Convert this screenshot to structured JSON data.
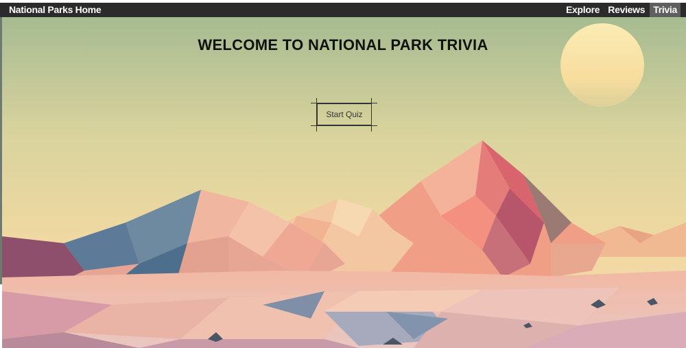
{
  "navbar": {
    "brand": "National Parks Home",
    "links": [
      {
        "label": "Explore",
        "active": false
      },
      {
        "label": "Reviews",
        "active": false
      },
      {
        "label": "Trivia",
        "active": true
      }
    ]
  },
  "hero": {
    "title": "WELCOME TO NATIONAL PARK TRIVIA",
    "start_button": "Start Quiz"
  },
  "colors": {
    "navbar_bg": "#2b2b2b",
    "active_tab_bg": "#5f5f5f",
    "sky_top": "#a6bb91",
    "sky_bottom": "#f2d9a2",
    "sun": "#f8e3a7"
  }
}
